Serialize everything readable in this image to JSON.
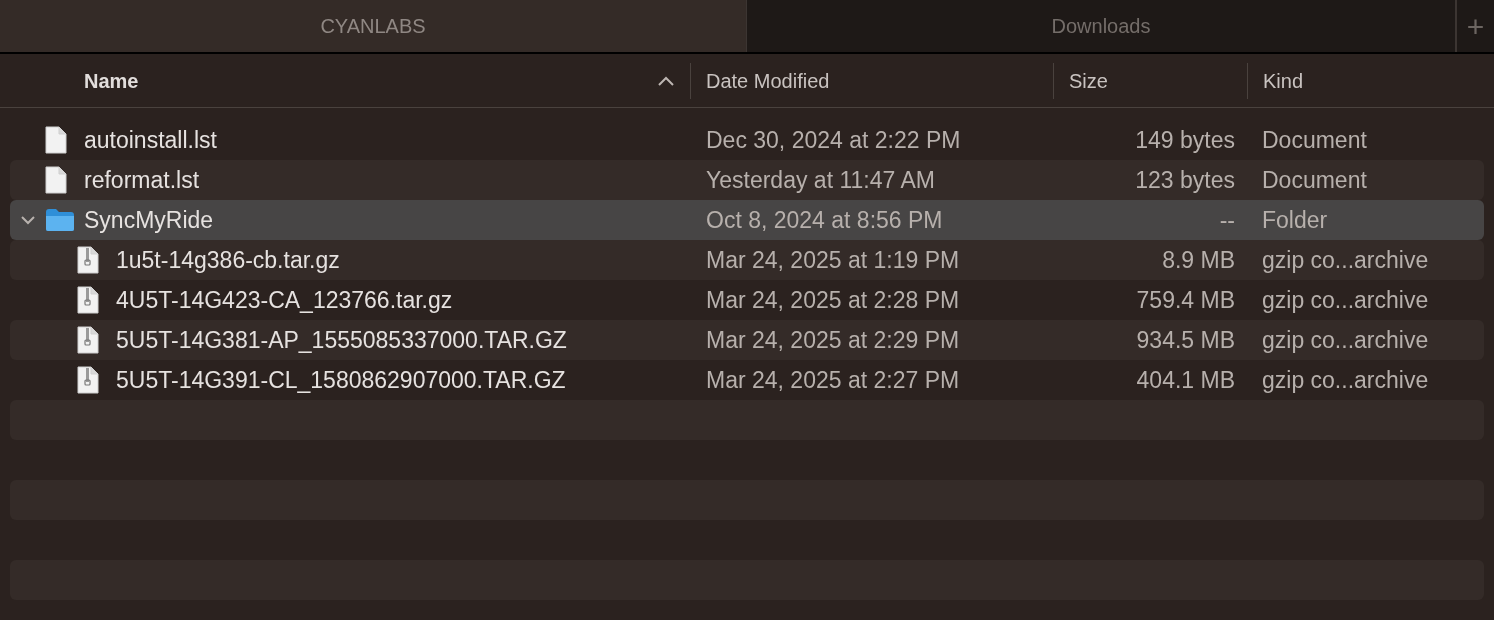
{
  "tabs": [
    {
      "label": "CYANLABS",
      "selected": true
    },
    {
      "label": "Downloads",
      "selected": false
    }
  ],
  "new_tab_button": {
    "label": "+"
  },
  "columns": [
    {
      "label": "Name",
      "sorted": true
    },
    {
      "label": "Date Modified",
      "sorted": false
    },
    {
      "label": "Size",
      "sorted": false
    },
    {
      "label": "Kind",
      "sorted": false
    }
  ],
  "rows": [
    {
      "kind": "document",
      "name": "autoinstall.lst",
      "date": "Dec 30, 2024 at 2:22 PM",
      "size": "149 bytes",
      "type": "Document",
      "selected": false
    },
    {
      "kind": "document",
      "name": "reformat.lst",
      "date": "Yesterday at 11:47 AM",
      "size": "123 bytes",
      "type": "Document",
      "selected": false
    },
    {
      "kind": "folder",
      "name": "SyncMyRide",
      "date": "Oct 8, 2024 at 8:56 PM",
      "size": "--",
      "type": "Folder",
      "selected": true,
      "expanded": true,
      "children": [
        {
          "kind": "archive",
          "name": "1u5t-14g386-cb.tar.gz",
          "date": "Mar 24, 2025 at 1:19 PM",
          "size": "8.9 MB",
          "type": "gzip co...archive",
          "selected": false
        },
        {
          "kind": "archive",
          "name": "4U5T-14G423-CA_123766.tar.gz",
          "date": "Mar 24, 2025 at 2:28 PM",
          "size": "759.4 MB",
          "type": "gzip co...archive",
          "selected": false
        },
        {
          "kind": "archive",
          "name": "5U5T-14G381-AP_1555085337000.TAR.GZ",
          "date": "Mar 24, 2025 at 2:29 PM",
          "size": "934.5 MB",
          "type": "gzip co...archive",
          "selected": false
        },
        {
          "kind": "archive",
          "name": "5U5T-14G391-CL_1580862907000.TAR.GZ",
          "date": "Mar 24, 2025 at 2:27 PM",
          "size": "404.1 MB",
          "type": "gzip co...archive",
          "selected": false
        }
      ]
    }
  ]
}
